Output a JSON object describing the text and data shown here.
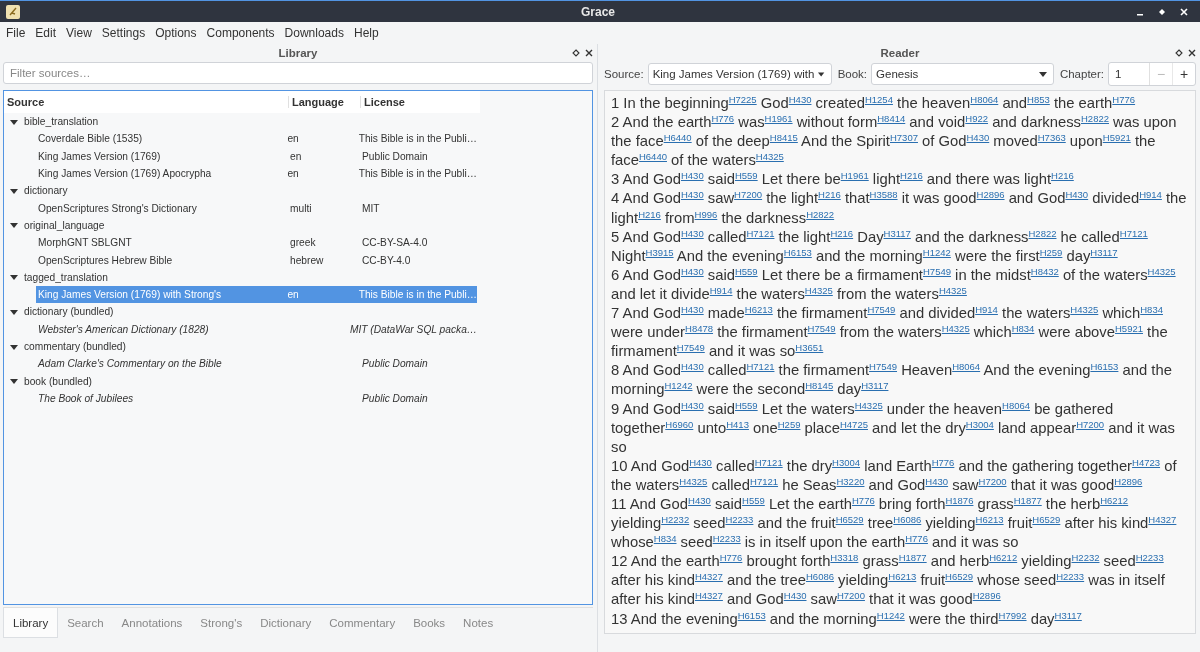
{
  "window": {
    "title": "Grace"
  },
  "menu": [
    "File",
    "Edit",
    "View",
    "Settings",
    "Options",
    "Components",
    "Downloads",
    "Help"
  ],
  "library": {
    "title": "Library",
    "filter": {
      "placeholder": "Filter sources…"
    },
    "columns": [
      "Source",
      "Language",
      "License"
    ],
    "groups": [
      {
        "name": "bible_translation",
        "expanded": true,
        "children": [
          {
            "source": "Coverdale Bible (1535)",
            "language": "en",
            "license": "This Bible is in the Publi…",
            "kind": "installed",
            "selected": false
          },
          {
            "source": "King James Version (1769)",
            "language": "en",
            "license": "Public Domain",
            "kind": "installed",
            "selected": false
          },
          {
            "source": "King James Version (1769) Apocrypha",
            "language": "en",
            "license": "This Bible is in the Publi…",
            "kind": "installed",
            "selected": false
          }
        ]
      },
      {
        "name": "dictionary",
        "expanded": true,
        "children": [
          {
            "source": "OpenScriptures Strong's Dictionary",
            "language": "multi",
            "license": "MIT",
            "kind": "installed",
            "selected": false
          }
        ]
      },
      {
        "name": "original_language",
        "expanded": true,
        "children": [
          {
            "source": "MorphGNT SBLGNT",
            "language": "greek",
            "license": "CC-BY-SA-4.0",
            "kind": "installed",
            "selected": false
          },
          {
            "source": "OpenScriptures Hebrew Bible",
            "language": "hebrew",
            "license": "CC-BY-4.0",
            "kind": "installed",
            "selected": false
          }
        ]
      },
      {
        "name": "tagged_translation",
        "expanded": true,
        "children": [
          {
            "source": "King James Version (1769) with Strong's",
            "language": "en",
            "license": "This Bible is in the Publi…",
            "kind": "installed",
            "selected": true
          }
        ]
      },
      {
        "name": "dictionary (bundled)",
        "expanded": true,
        "children": [
          {
            "source": "Webster's American Dictionary (1828)",
            "license": "MIT (DataWar SQL packa…",
            "kind": "bundled",
            "selected": false
          }
        ]
      },
      {
        "name": "commentary (bundled)",
        "expanded": true,
        "children": [
          {
            "source": "Adam Clarke's Commentary on the Bible",
            "license": "Public Domain",
            "kind": "bundled",
            "selected": false
          }
        ]
      },
      {
        "name": "book (bundled)",
        "expanded": true,
        "children": [
          {
            "source": "The Book of Jubilees",
            "license": "Public Domain",
            "kind": "bundled",
            "selected": false
          }
        ]
      }
    ]
  },
  "tabs": [
    {
      "label": "Library",
      "selected": true
    },
    {
      "label": "Search",
      "selected": false
    },
    {
      "label": "Annotations",
      "selected": false
    },
    {
      "label": "Strong's",
      "selected": false
    },
    {
      "label": "Dictionary",
      "selected": false
    },
    {
      "label": "Commentary",
      "selected": false
    },
    {
      "label": "Books",
      "selected": false
    },
    {
      "label": "Notes",
      "selected": false
    }
  ],
  "reader": {
    "title": "Reader",
    "source_label": "Source:",
    "source": "King James Version (1769) with",
    "book_label": "Book:",
    "book": "Genesis",
    "chapter_label": "Chapter:",
    "chapter": "1",
    "minus": "−",
    "plus": "+",
    "verses": [
      {
        "number": "1",
        "segments": [
          {
            "text": "In the beginning",
            "ref": "H7225"
          },
          {
            "text": "God",
            "ref": "H430"
          },
          {
            "text": "created",
            "ref": "H1254"
          },
          {
            "text": "the heaven",
            "ref": "H8064"
          },
          {
            "text": "and",
            "ref": "H853"
          },
          {
            "text": "the earth",
            "ref": "H776"
          }
        ]
      },
      {
        "number": "2",
        "segments": [
          {
            "text": "And the earth",
            "ref": "H776"
          },
          {
            "text": "was",
            "ref": "H1961"
          },
          {
            "text": "without form",
            "ref": "H8414"
          },
          {
            "text": "and void",
            "ref": "H922"
          },
          {
            "text": "and darkness",
            "ref": "H2822"
          },
          {
            "text": "was upon the face",
            "ref": "H6440"
          },
          {
            "text": "of the deep",
            "ref": "H8415"
          },
          {
            "text": "And the Spirit",
            "ref": "H7307"
          },
          {
            "text": "of God",
            "ref": "H430"
          },
          {
            "text": "moved",
            "ref": "H7363"
          },
          {
            "text": "upon",
            "ref": "H5921"
          },
          {
            "text": "the face",
            "ref": "H6440"
          },
          {
            "text": "of the waters",
            "ref": "H4325"
          }
        ]
      },
      {
        "number": "3",
        "segments": [
          {
            "text": "And God",
            "ref": "H430"
          },
          {
            "text": "said",
            "ref": "H559"
          },
          {
            "text": "Let there be",
            "ref": "H1961"
          },
          {
            "text": "light",
            "ref": "H216"
          },
          {
            "text": "and there was light",
            "ref": "H216"
          }
        ]
      },
      {
        "number": "4",
        "segments": [
          {
            "text": "And God",
            "ref": "H430"
          },
          {
            "text": "saw",
            "ref": "H7200"
          },
          {
            "text": "the light",
            "ref": "H216"
          },
          {
            "text": "that",
            "ref": "H3588"
          },
          {
            "text": "it was good",
            "ref": "H2896"
          },
          {
            "text": "and God",
            "ref": "H430"
          },
          {
            "text": "divided",
            "ref": "H914"
          },
          {
            "text": "the light",
            "ref": "H216"
          },
          {
            "text": "from",
            "ref": "H996"
          },
          {
            "text": "the darkness",
            "ref": "H2822"
          }
        ]
      },
      {
        "number": "5",
        "segments": [
          {
            "text": "And God",
            "ref": "H430"
          },
          {
            "text": "called",
            "ref": "H7121"
          },
          {
            "text": "the light",
            "ref": "H216"
          },
          {
            "text": "Day",
            "ref": "H3117"
          },
          {
            "text": "and the darkness",
            "ref": "H2822"
          },
          {
            "text": "he called",
            "ref": "H7121"
          },
          {
            "text": "Night",
            "ref": "H3915"
          },
          {
            "text": "And the evening",
            "ref": "H6153"
          },
          {
            "text": "and the morning",
            "ref": "H1242"
          },
          {
            "text": "were the first",
            "ref": "H259"
          },
          {
            "text": "day",
            "ref": "H3117"
          }
        ]
      },
      {
        "number": "6",
        "segments": [
          {
            "text": "And God",
            "ref": "H430"
          },
          {
            "text": "said",
            "ref": "H559"
          },
          {
            "text": "Let there be a firmament",
            "ref": "H7549"
          },
          {
            "text": "in the midst",
            "ref": "H8432"
          },
          {
            "text": "of the waters",
            "ref": "H4325"
          },
          {
            "text": "and let it divide",
            "ref": "H914"
          },
          {
            "text": "the waters",
            "ref": "H4325"
          },
          {
            "text": "from the waters",
            "ref": "H4325"
          }
        ]
      },
      {
        "number": "7",
        "segments": [
          {
            "text": "And God",
            "ref": "H430"
          },
          {
            "text": "made",
            "ref": "H6213"
          },
          {
            "text": "the firmament",
            "ref": "H7549"
          },
          {
            "text": "and divided",
            "ref": "H914"
          },
          {
            "text": "the waters",
            "ref": "H4325"
          },
          {
            "text": "which",
            "ref": "H834"
          },
          {
            "text": "were under",
            "ref": "H8478"
          },
          {
            "text": "the firmament",
            "ref": "H7549"
          },
          {
            "text": "from the waters",
            "ref": "H4325"
          },
          {
            "text": "which",
            "ref": "H834"
          },
          {
            "text": "were above",
            "ref": "H5921"
          },
          {
            "text": "the firmament",
            "ref": "H7549"
          },
          {
            "text": "and it was so",
            "ref": "H3651"
          }
        ]
      },
      {
        "number": "8",
        "segments": [
          {
            "text": "And God",
            "ref": "H430"
          },
          {
            "text": "called",
            "ref": "H7121"
          },
          {
            "text": "the firmament",
            "ref": "H7549"
          },
          {
            "text": "Heaven",
            "ref": "H8064"
          },
          {
            "text": "And the evening",
            "ref": "H6153"
          },
          {
            "text": "and the morning",
            "ref": "H1242"
          },
          {
            "text": "were the second",
            "ref": "H8145"
          },
          {
            "text": "day",
            "ref": "H3117"
          }
        ]
      },
      {
        "number": "9",
        "segments": [
          {
            "text": "And God",
            "ref": "H430"
          },
          {
            "text": "said",
            "ref": "H559"
          },
          {
            "text": "Let the waters",
            "ref": "H4325"
          },
          {
            "text": "under the heaven",
            "ref": "H8064"
          },
          {
            "text": "be gathered together",
            "ref": "H6960"
          },
          {
            "text": "unto",
            "ref": "H413"
          },
          {
            "text": "one",
            "ref": "H259"
          },
          {
            "text": "place",
            "ref": "H4725"
          },
          {
            "text": "and let the dry",
            "ref": "H3004"
          },
          {
            "text": "land appear",
            "ref": "H7200"
          },
          {
            "text": "and it was so"
          }
        ]
      },
      {
        "number": "10",
        "segments": [
          {
            "text": "And God",
            "ref": "H430"
          },
          {
            "text": "called",
            "ref": "H7121"
          },
          {
            "text": "the dry",
            "ref": "H3004"
          },
          {
            "text": "land Earth",
            "ref": "H776"
          },
          {
            "text": "and the gathering together",
            "ref": "H4723"
          },
          {
            "text": "of the waters",
            "ref": "H4325"
          },
          {
            "text": "called",
            "ref": "H7121"
          },
          {
            "text": "he Seas",
            "ref": "H3220"
          },
          {
            "text": "and God",
            "ref": "H430"
          },
          {
            "text": "saw",
            "ref": "H7200"
          },
          {
            "text": "that it was good",
            "ref": "H2896"
          }
        ]
      },
      {
        "number": "11",
        "segments": [
          {
            "text": "And God",
            "ref": "H430"
          },
          {
            "text": "said",
            "ref": "H559"
          },
          {
            "text": "Let the earth",
            "ref": "H776"
          },
          {
            "text": "bring forth",
            "ref": "H1876"
          },
          {
            "text": "grass",
            "ref": "H1877"
          },
          {
            "text": "the herb",
            "ref": "H6212"
          },
          {
            "text": "yielding",
            "ref": "H2232"
          },
          {
            "text": "seed",
            "ref": "H2233"
          },
          {
            "text": "and the fruit",
            "ref": "H6529"
          },
          {
            "text": "tree",
            "ref": "H6086"
          },
          {
            "text": "yielding",
            "ref": "H6213"
          },
          {
            "text": "fruit",
            "ref": "H6529"
          },
          {
            "text": "after his kind",
            "ref": "H4327"
          },
          {
            "text": "whose",
            "ref": "H834"
          },
          {
            "text": "seed",
            "ref": "H2233"
          },
          {
            "text": "is in itself upon the earth",
            "ref": "H776"
          },
          {
            "text": "and it was so"
          }
        ]
      },
      {
        "number": "12",
        "segments": [
          {
            "text": "And the earth",
            "ref": "H776"
          },
          {
            "text": "brought forth",
            "ref": "H3318"
          },
          {
            "text": "grass",
            "ref": "H1877"
          },
          {
            "text": "and herb",
            "ref": "H6212"
          },
          {
            "text": "yielding",
            "ref": "H2232"
          },
          {
            "text": "seed",
            "ref": "H2233"
          },
          {
            "text": "after his kind",
            "ref": "H4327"
          },
          {
            "text": "and the tree",
            "ref": "H6086"
          },
          {
            "text": "yielding",
            "ref": "H6213"
          },
          {
            "text": "fruit",
            "ref": "H6529"
          },
          {
            "text": "whose seed",
            "ref": "H2233"
          },
          {
            "text": "was in itself after his kind",
            "ref": "H4327"
          },
          {
            "text": "and God",
            "ref": "H430"
          },
          {
            "text": "saw",
            "ref": "H7200"
          },
          {
            "text": "that it was good",
            "ref": "H2896"
          }
        ]
      },
      {
        "number": "13",
        "segments": [
          {
            "text": "And the evening",
            "ref": "H6153"
          },
          {
            "text": "and the morning",
            "ref": "H1242"
          },
          {
            "text": "were the third",
            "ref": "H7992"
          },
          {
            "text": "day",
            "ref": "H3117"
          }
        ]
      }
    ]
  }
}
